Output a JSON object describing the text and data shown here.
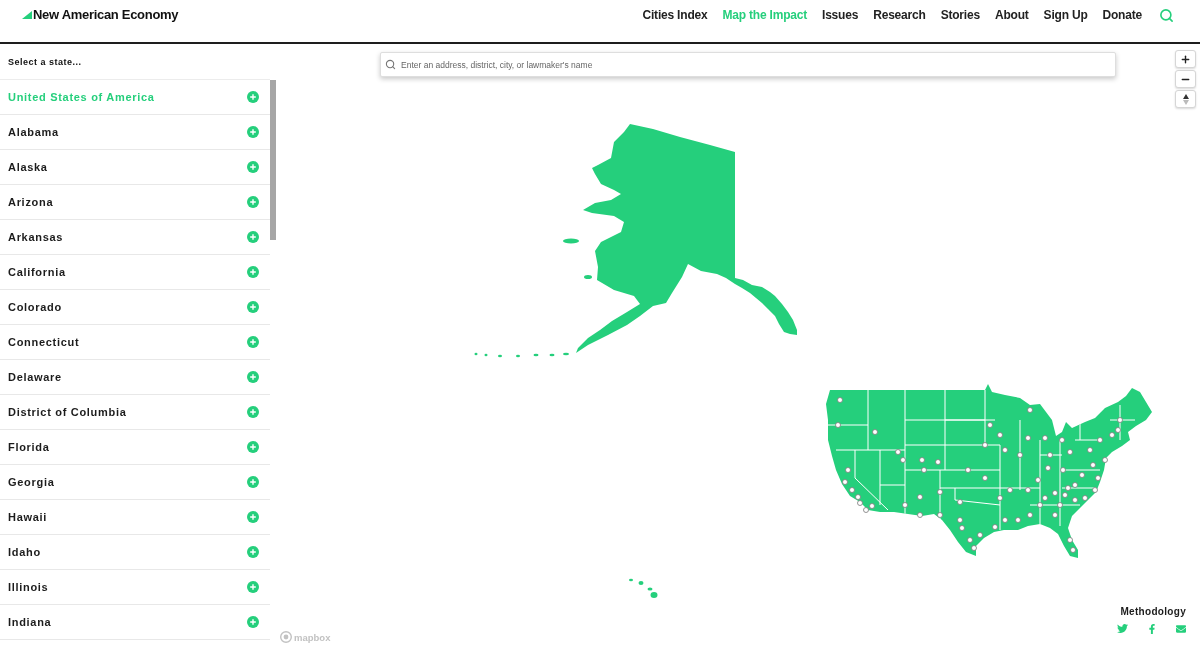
{
  "header": {
    "logo": "New American Economy",
    "nav": [
      {
        "label": "Cities Index",
        "selected": false
      },
      {
        "label": "Map the Impact",
        "selected": true
      },
      {
        "label": "Issues",
        "selected": false
      },
      {
        "label": "Research",
        "selected": false
      },
      {
        "label": "Stories",
        "selected": false
      },
      {
        "label": "About",
        "selected": false
      },
      {
        "label": "Sign Up",
        "selected": false
      },
      {
        "label": "Donate",
        "selected": false
      }
    ]
  },
  "sidebar": {
    "prompt": "Select a state...",
    "states": [
      {
        "name": "United States of America",
        "selected": true
      },
      {
        "name": "Alabama",
        "selected": false
      },
      {
        "name": "Alaska",
        "selected": false
      },
      {
        "name": "Arizona",
        "selected": false
      },
      {
        "name": "Arkansas",
        "selected": false
      },
      {
        "name": "California",
        "selected": false
      },
      {
        "name": "Colorado",
        "selected": false
      },
      {
        "name": "Connecticut",
        "selected": false
      },
      {
        "name": "Delaware",
        "selected": false
      },
      {
        "name": "District of Columbia",
        "selected": false
      },
      {
        "name": "Florida",
        "selected": false
      },
      {
        "name": "Georgia",
        "selected": false
      },
      {
        "name": "Hawaii",
        "selected": false
      },
      {
        "name": "Idaho",
        "selected": false
      },
      {
        "name": "Illinois",
        "selected": false
      },
      {
        "name": "Indiana",
        "selected": false
      }
    ]
  },
  "map": {
    "search": {
      "placeholder": "Enter an address, district, city, or lawmaker's name"
    },
    "attribution": "mapbox"
  },
  "footer": {
    "link": "Methodology"
  }
}
